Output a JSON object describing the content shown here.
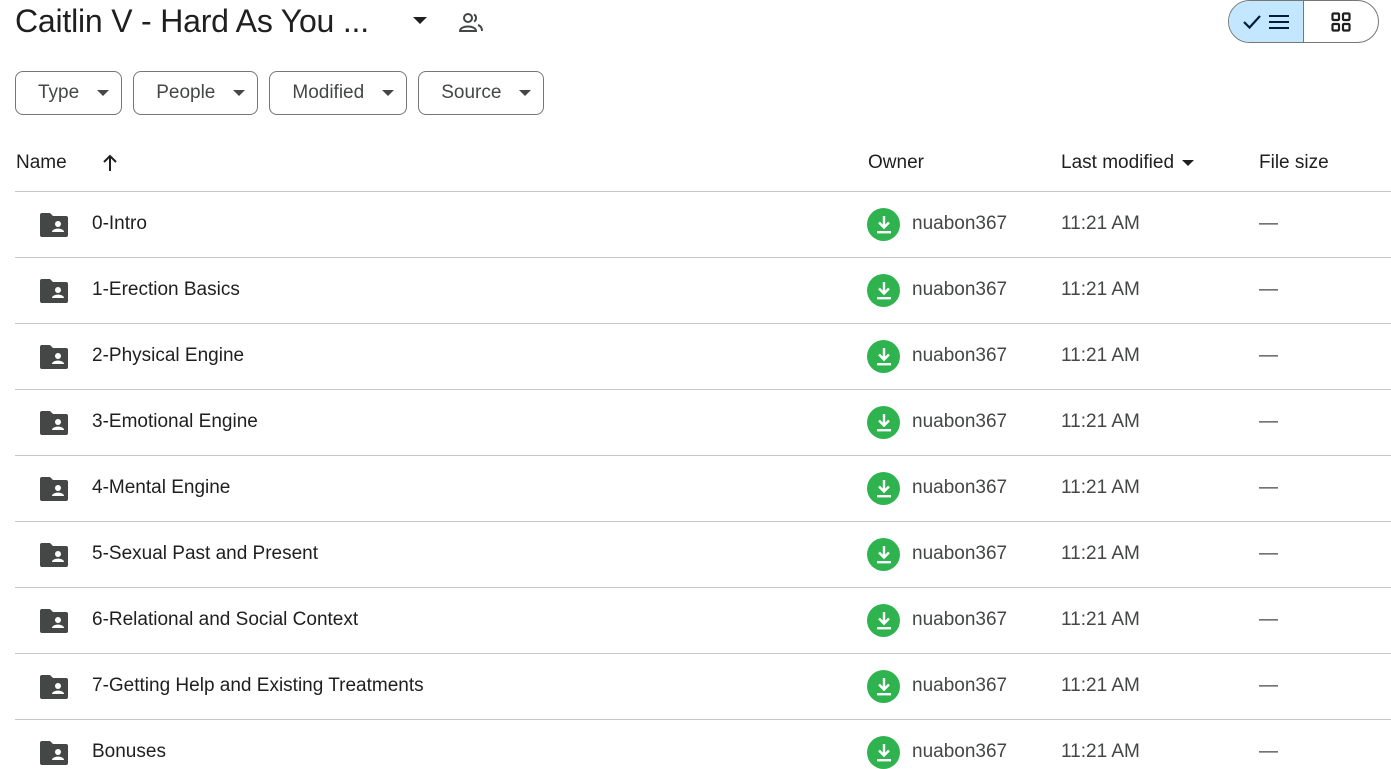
{
  "header": {
    "title": "Caitlin V - Hard As You ...",
    "caret_icon": "arrow-drop-down-icon",
    "share_icon": "people-icon",
    "view_toggle": {
      "list_icon": "checkmark-list-icon",
      "grid_icon": "grid-icon",
      "active": "list",
      "active_color": "#c2e7ff"
    }
  },
  "filters": [
    {
      "label": "Type"
    },
    {
      "label": "People"
    },
    {
      "label": "Modified"
    },
    {
      "label": "Source"
    }
  ],
  "table": {
    "columns": {
      "name": "Name",
      "owner": "Owner",
      "last_modified": "Last modified",
      "file_size": "File size"
    },
    "sort_icon": "arrow-up-icon",
    "rows": [
      {
        "name": "0-Intro",
        "owner": "nuabon367",
        "modified": "11:21 AM",
        "size": "—"
      },
      {
        "name": "1-Erection Basics",
        "owner": "nuabon367",
        "modified": "11:21 AM",
        "size": "—"
      },
      {
        "name": "2-Physical Engine",
        "owner": "nuabon367",
        "modified": "11:21 AM",
        "size": "—"
      },
      {
        "name": "3-Emotional Engine",
        "owner": "nuabon367",
        "modified": "11:21 AM",
        "size": "—"
      },
      {
        "name": "4-Mental Engine",
        "owner": "nuabon367",
        "modified": "11:21 AM",
        "size": "—"
      },
      {
        "name": "5-Sexual Past and Present",
        "owner": "nuabon367",
        "modified": "11:21 AM",
        "size": "—"
      },
      {
        "name": "6-Relational and Social Context",
        "owner": "nuabon367",
        "modified": "11:21 AM",
        "size": "—"
      },
      {
        "name": "7-Getting Help and Existing Treatments",
        "owner": "nuabon367",
        "modified": "11:21 AM",
        "size": "—"
      },
      {
        "name": "Bonuses",
        "owner": "nuabon367",
        "modified": "11:21 AM",
        "size": "—"
      }
    ]
  },
  "colors": {
    "owner_avatar": "#2eb34f",
    "folder": "#444746",
    "divider": "#c4c7c5"
  }
}
